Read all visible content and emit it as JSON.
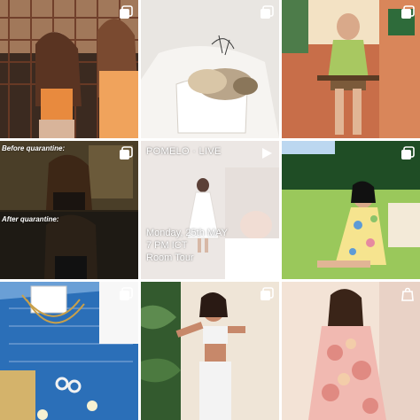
{
  "grid": {
    "background": "#ffffff",
    "tiles": [
      {
        "id": "tile-1",
        "badge": "carousel",
        "palette": [
          "#3b2a20",
          "#d8b49a",
          "#8a5a3c",
          "#e88a3e"
        ]
      },
      {
        "id": "tile-2",
        "badge": "carousel",
        "palette": [
          "#e9e6e2",
          "#ffffff",
          "#b9a58a",
          "#f4f1ec"
        ]
      },
      {
        "id": "tile-3",
        "badge": "carousel",
        "palette": [
          "#d97b54",
          "#f3e2c4",
          "#7b5a3a",
          "#2e6b3a"
        ]
      },
      {
        "id": "tile-4",
        "badge": "carousel",
        "palette": [
          "#2a2216",
          "#6b5a3a",
          "#1a1410",
          "#c7a67a"
        ]
      },
      {
        "id": "tile-5",
        "badge": "video",
        "palette": [
          "#ece7e4",
          "#ffffff",
          "#d8cfc8",
          "#7c6b66"
        ]
      },
      {
        "id": "tile-6",
        "badge": "carousel",
        "palette": [
          "#1f4d25",
          "#9ac85b",
          "#f6e48f",
          "#5d9bd6"
        ]
      },
      {
        "id": "tile-7",
        "badge": "carousel",
        "palette": [
          "#6a9fd6",
          "#2b6fb8",
          "#d4b36b",
          "#f7f7f7"
        ]
      },
      {
        "id": "tile-8",
        "badge": "carousel",
        "palette": [
          "#335a2e",
          "#f3f3f3",
          "#b86a4f",
          "#efe5d7"
        ]
      },
      {
        "id": "tile-9",
        "badge": "shopping",
        "palette": [
          "#f1b9b1",
          "#f3e3d6",
          "#dd7f77",
          "#e9d2c6"
        ]
      }
    ],
    "captions": {
      "before": "Before quarantine:",
      "after": "After quarantine:",
      "brand": "POMELO · LIVE",
      "date": "Monday, 25th MAY",
      "time": "7 PM ICT",
      "event": "Room Tour"
    }
  }
}
